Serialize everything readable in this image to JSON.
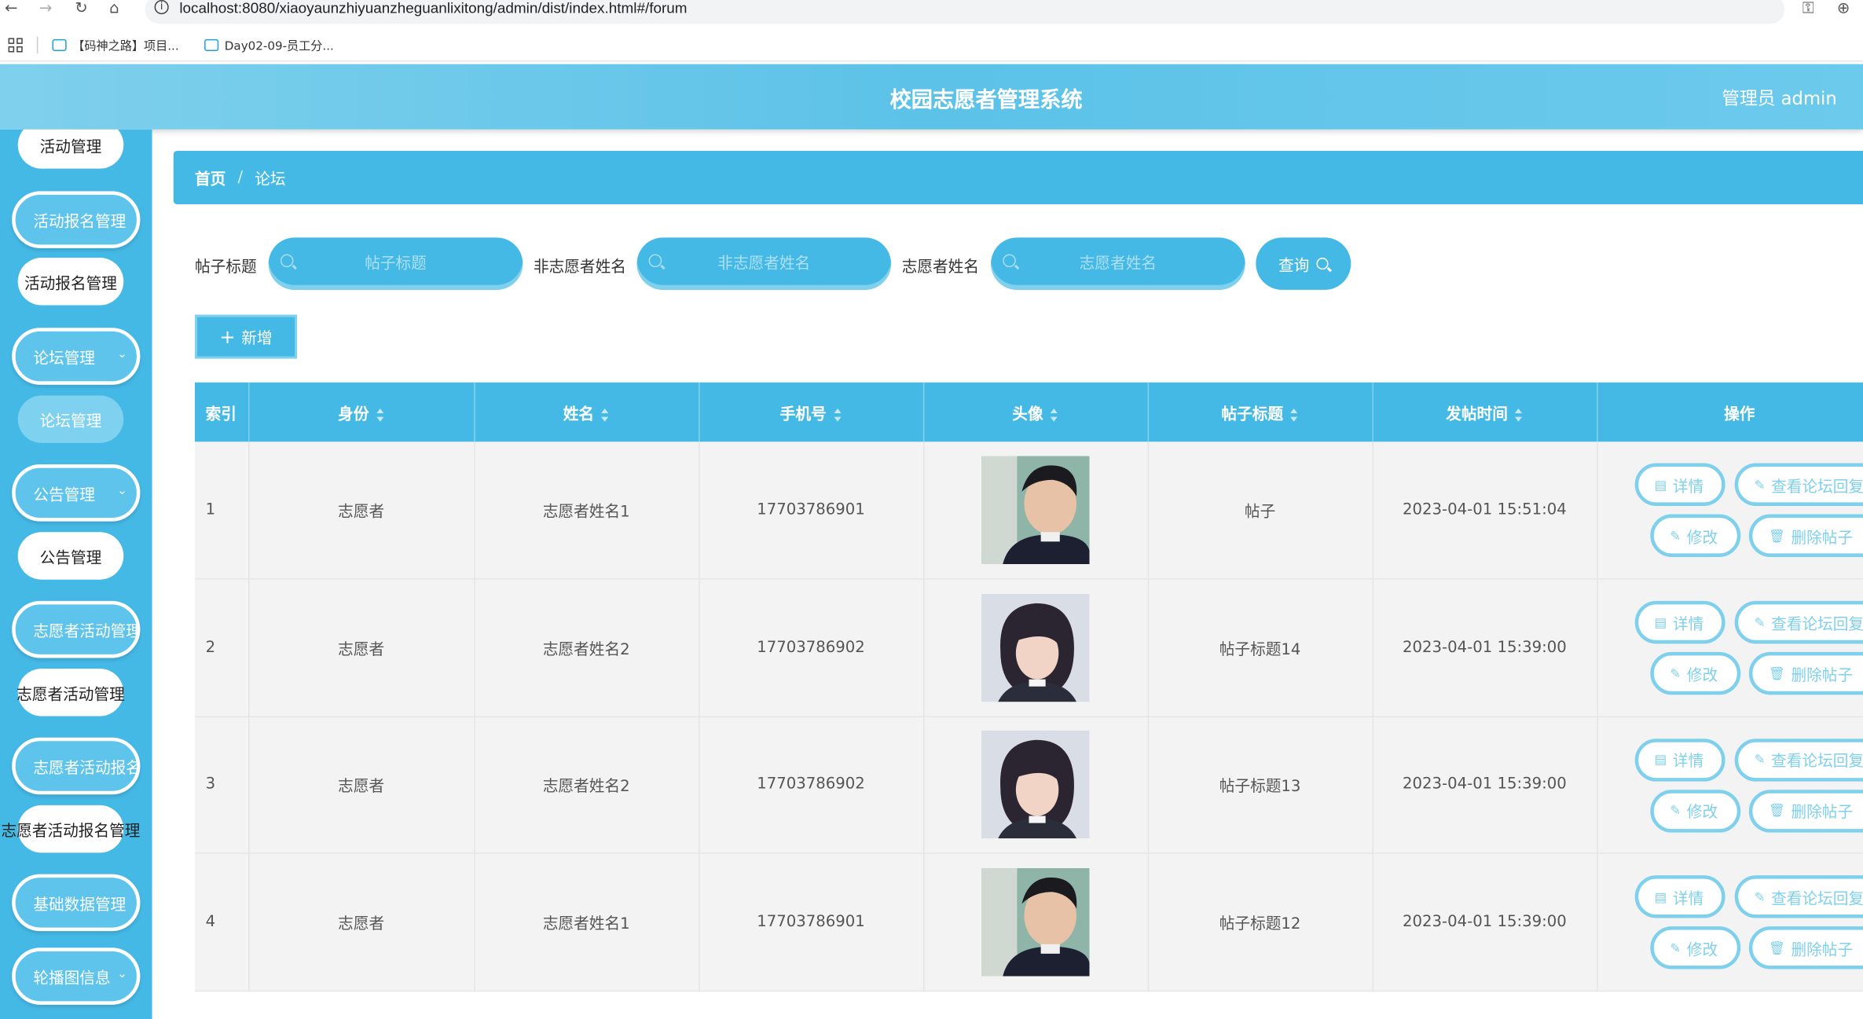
{
  "browser": {
    "url": "localhost:8080/xiaoyaunzhiyuanzheguanlixitong/admin/dist/index.html#/forum",
    "bookmarks": [
      "【码神之路】项目...",
      "Day02-09-员工分..."
    ]
  },
  "header": {
    "title": "校园志愿者管理系统",
    "admin": "管理员 admin"
  },
  "sidebar": {
    "groups": [
      {
        "label": "活动管理",
        "type": "item"
      },
      {
        "label": "活动报名管理",
        "type": "group"
      },
      {
        "label": "活动报名管理",
        "type": "item"
      },
      {
        "label": "论坛管理",
        "type": "group"
      },
      {
        "label": "论坛管理",
        "type": "item",
        "active": true
      },
      {
        "label": "公告管理",
        "type": "group"
      },
      {
        "label": "公告管理",
        "type": "item"
      },
      {
        "label": "志愿者活动管理",
        "type": "group"
      },
      {
        "label": "志愿者活动管理",
        "type": "item"
      },
      {
        "label": "志愿者活动报名管",
        "type": "group"
      },
      {
        "label": "志愿者活动报名管理",
        "type": "item"
      },
      {
        "label": "基础数据管理",
        "type": "group"
      },
      {
        "label": "轮播图信息",
        "type": "group"
      }
    ]
  },
  "breadcrumb": {
    "home": "首页",
    "separator": "/",
    "current": "论坛"
  },
  "search": {
    "fields": [
      {
        "label": "帖子标题",
        "placeholder": "帖子标题"
      },
      {
        "label": "非志愿者姓名",
        "placeholder": "非志愿者姓名"
      },
      {
        "label": "志愿者姓名",
        "placeholder": "志愿者姓名"
      }
    ],
    "query_label": "查询"
  },
  "actions": {
    "add_label": "新增"
  },
  "table": {
    "columns": [
      "索引",
      "身份",
      "姓名",
      "手机号",
      "头像",
      "帖子标题",
      "发帖时间",
      "操作"
    ],
    "rows": [
      {
        "index": "1",
        "identity": "志愿者",
        "name": "志愿者姓名1",
        "phone": "17703786901",
        "avatar": "male",
        "title": "帖子",
        "time": "2023-04-01 15:51:04"
      },
      {
        "index": "2",
        "identity": "志愿者",
        "name": "志愿者姓名2",
        "phone": "17703786902",
        "avatar": "female",
        "title": "帖子标题14",
        "time": "2023-04-01 15:39:00"
      },
      {
        "index": "3",
        "identity": "志愿者",
        "name": "志愿者姓名2",
        "phone": "17703786902",
        "avatar": "female",
        "title": "帖子标题13",
        "time": "2023-04-01 15:39:00"
      },
      {
        "index": "4",
        "identity": "志愿者",
        "name": "志愿者姓名1",
        "phone": "17703786901",
        "avatar": "male",
        "title": "帖子标题12",
        "time": "2023-04-01 15:39:00"
      }
    ],
    "ops": {
      "detail": "详情",
      "view_reply": "查看论坛回复",
      "edit": "修改",
      "delete": "删除帖子"
    }
  },
  "colors": {
    "primary": "#45b9e6",
    "light": "#7fd0ec",
    "row_bg": "#f3f3f3"
  }
}
